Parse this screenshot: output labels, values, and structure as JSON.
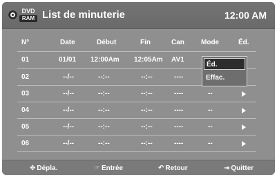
{
  "header": {
    "badge_top": "DVD",
    "badge_bottom": "RAM",
    "title": "List de minuterie",
    "clock": "12:00 AM"
  },
  "table": {
    "columns": [
      "N°",
      "Date",
      "Début",
      "Fin",
      "Can",
      "Mode",
      "Éd."
    ],
    "rows": [
      {
        "no": "01",
        "date": "01/01",
        "start": "12:00Am",
        "end": "12:05Am",
        "ch": "AV1",
        "mode": "",
        "has_arrow": false
      },
      {
        "no": "02",
        "date": "--/--",
        "start": "--:--",
        "end": "--:--",
        "ch": "----",
        "mode": "",
        "has_arrow": false
      },
      {
        "no": "03",
        "date": "--/--",
        "start": "--:--",
        "end": "--:--",
        "ch": "----",
        "mode": "--",
        "has_arrow": true
      },
      {
        "no": "04",
        "date": "--/--",
        "start": "--:--",
        "end": "--:--",
        "ch": "----",
        "mode": "--",
        "has_arrow": true
      },
      {
        "no": "05",
        "date": "--/--",
        "start": "--:--",
        "end": "--:--",
        "ch": "----",
        "mode": "--",
        "has_arrow": true
      },
      {
        "no": "06",
        "date": "--/--",
        "start": "--:--",
        "end": "--:--",
        "ch": "----",
        "mode": "--",
        "has_arrow": true
      }
    ]
  },
  "popup": {
    "items": [
      "Éd.",
      "Effac."
    ],
    "selected": "Éd."
  },
  "footer": {
    "move": {
      "icon": "dpad-icon",
      "label": "Dépla."
    },
    "enter": {
      "icon": "enter-icon",
      "label": "Entrée"
    },
    "back": {
      "icon": "return-icon",
      "label": "Retour"
    },
    "exit": {
      "icon": "exit-icon",
      "label": "Quitter"
    }
  }
}
